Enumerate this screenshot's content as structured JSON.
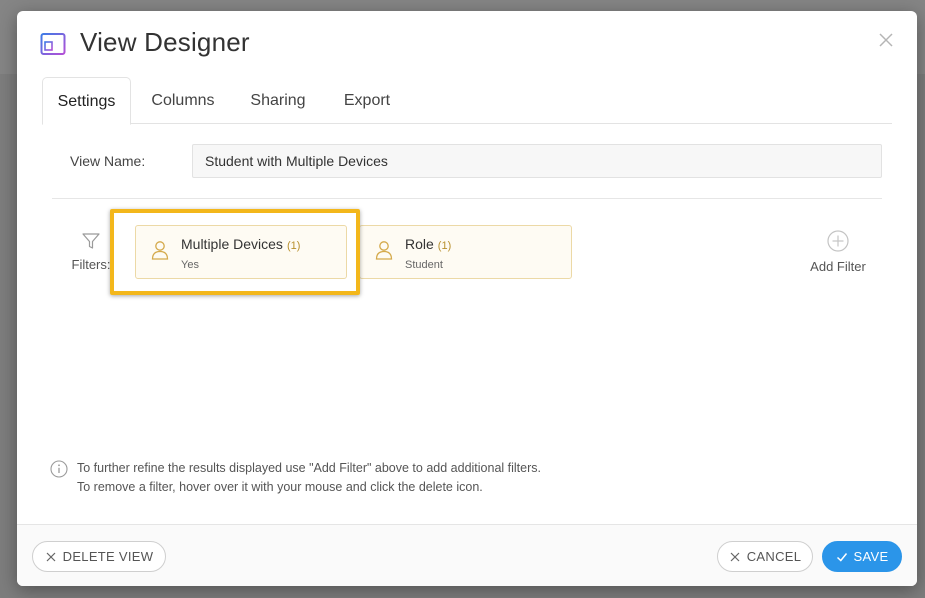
{
  "dialog": {
    "title": "View Designer",
    "close_icon": "close-icon",
    "title_icon": "view-designer-icon"
  },
  "tabs": [
    {
      "label": "Settings",
      "active": true
    },
    {
      "label": "Columns",
      "active": false
    },
    {
      "label": "Sharing",
      "active": false
    },
    {
      "label": "Export",
      "active": false
    }
  ],
  "view_name": {
    "label": "View Name:",
    "value": "Student with Multiple Devices"
  },
  "filters": {
    "label": "Filters:",
    "icon": "funnel-icon",
    "items": [
      {
        "name": "Multiple Devices",
        "count": "(1)",
        "value": "Yes",
        "icon": "person-icon",
        "highlighted": true
      },
      {
        "name": "Role",
        "count": "(1)",
        "value": "Student",
        "icon": "person-icon",
        "highlighted": false
      }
    ],
    "add_label": "Add Filter"
  },
  "info": {
    "line1": "To further refine the results displayed use \"Add Filter\" above to add additional filters.",
    "line2": "To remove a filter, hover over it with your mouse and click the delete icon."
  },
  "footer": {
    "delete_label": "DELETE VIEW",
    "cancel_label": "CANCEL",
    "save_label": "SAVE"
  },
  "colors": {
    "accent": "#2b95e9",
    "highlight": "#f3b71b",
    "chip_bg": "#fefbf3",
    "chip_icon": "#d4a94a"
  }
}
